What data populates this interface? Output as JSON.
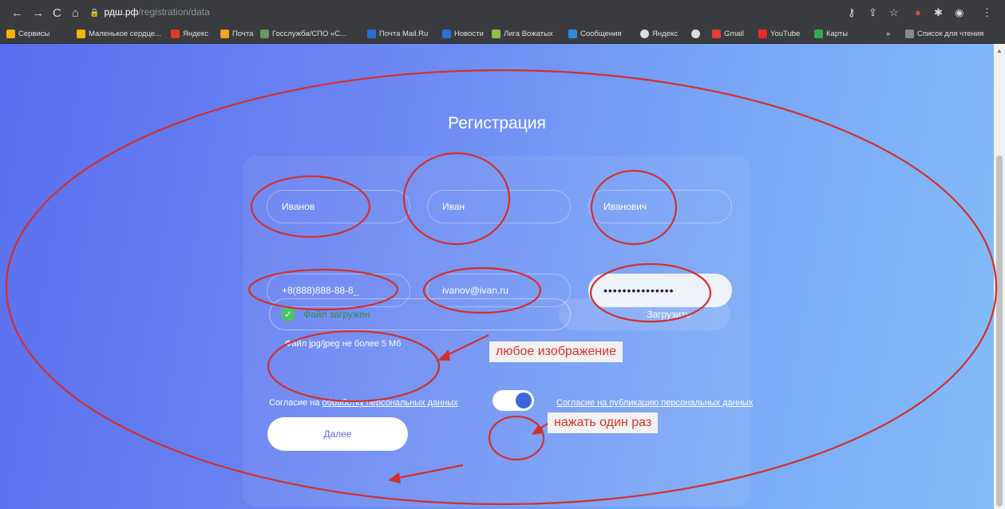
{
  "browser": {
    "nav": {
      "back": "←",
      "forward": "→",
      "reload": "C",
      "home": "⌂"
    },
    "url": {
      "host": "рдш.рф",
      "path": "/registration/data"
    },
    "bookmarks": [
      {
        "label": "Сервисы",
        "color": "#f4b400"
      },
      {
        "label": "Маленькое сердце...",
        "color": "#f4b400"
      },
      {
        "label": "Яндекс",
        "color": "#e03b2b"
      },
      {
        "label": "Почта",
        "color": "#f3a21b"
      },
      {
        "label": "Госслужба/СПО «С...",
        "color": "#6a9a5b"
      },
      {
        "label": "Почта Mail.Ru",
        "color": "#2b6fd6"
      },
      {
        "label": "Новости",
        "color": "#2b6fd6"
      },
      {
        "label": "Лига Вожатых",
        "color": "#8bc34a"
      },
      {
        "label": "Сообщения",
        "color": "#2b8ce0"
      },
      {
        "label": "Яндекс",
        "color": "#dddddd"
      },
      {
        "label": "",
        "color": "#dddddd"
      },
      {
        "label": "Gmail",
        "color": "#e34133"
      },
      {
        "label": "YouTube",
        "color": "#e52d27"
      },
      {
        "label": "Карты",
        "color": "#34a853"
      }
    ],
    "reading_list": "Список для чтения"
  },
  "page": {
    "title": "Регистрация",
    "fields": {
      "last_name": "Иванов",
      "first_name": "Иван",
      "middle_name": "Иванович",
      "phone": "+8(888)888-88-8_",
      "email": "ivanov@ivan.ru",
      "password": "•••••••••••••••"
    },
    "file": {
      "status": "Файл загружен",
      "upload_label": "Загрузить",
      "hint": "Файл jpg/jpeg не более 5 Мб"
    },
    "consent": {
      "prefix": "Согласие на ",
      "link": "обработку персональных данных",
      "right_link": "Согласие на публикацию персональных данных"
    },
    "next_label": "Далее"
  },
  "annotations": {
    "callout_image": "любое изображение",
    "callout_toggle": "нажать один раз"
  },
  "colors": {
    "annotation_red": "#d2302a",
    "page_gradient_start": "#5a6fee",
    "page_gradient_end": "#83bdf8"
  }
}
